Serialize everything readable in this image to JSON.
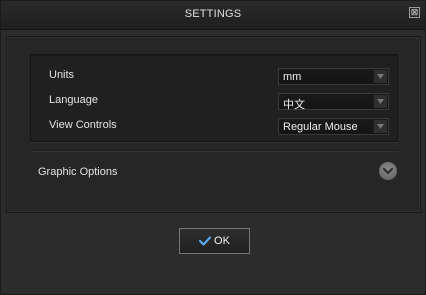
{
  "window": {
    "title": "SETTINGS",
    "close_glyph": "⊠"
  },
  "settings": {
    "rows": [
      {
        "label": "Units",
        "value": "mm"
      },
      {
        "label": "Language",
        "value": "中文"
      },
      {
        "label": "View Controls",
        "value": "Regular Mouse"
      }
    ]
  },
  "graphic_options": {
    "label": "Graphic Options",
    "icon": "chevron-down-icon"
  },
  "ok_button": {
    "label": "OK",
    "icon": "checkmark-icon",
    "icon_color": "#5aa9f0"
  }
}
